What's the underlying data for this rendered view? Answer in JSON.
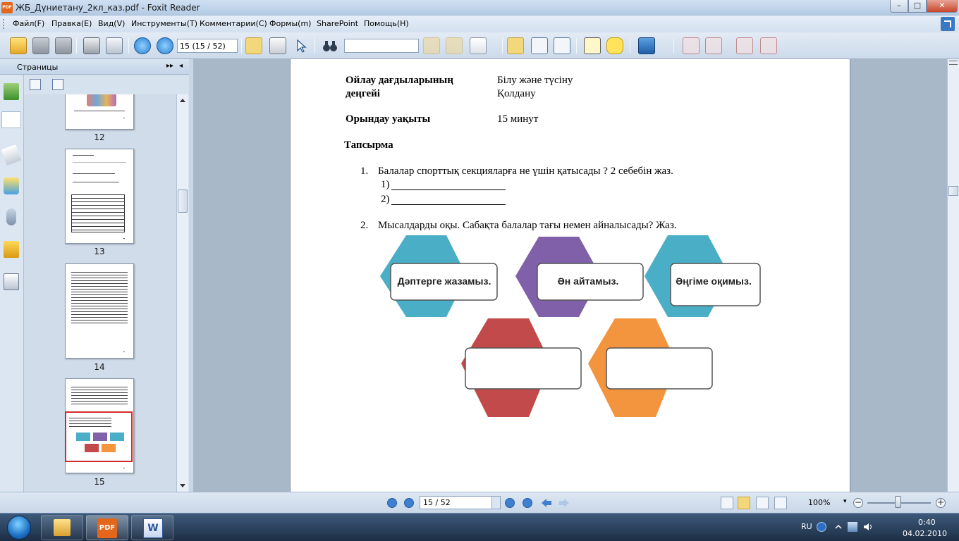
{
  "window": {
    "title": "ЖБ_Дүниетану_2кл_каз.pdf - Foxit Reader",
    "app_icon_label": "PDF",
    "minimize": "–",
    "maximize": "□",
    "close": "✕"
  },
  "menu": {
    "items": [
      "Файл(F)",
      "Правка(E)",
      "Вид(V)",
      "Инструменты(T)",
      "Комментарии(C)",
      "Формы(m)",
      "SharePoint",
      "Помощь(H)"
    ]
  },
  "toolbar": {
    "page_field": "15 (15 / 52)",
    "find_value": ""
  },
  "left_panel": {
    "title": "Страницы",
    "expand_btn": "▸▸",
    "collapse_btn": "◂",
    "thumbnails": [
      {
        "label": "12"
      },
      {
        "label": "13"
      },
      {
        "label": "14"
      },
      {
        "label": "15"
      }
    ]
  },
  "document": {
    "thinking_label_1": "Ойлау дағдыларының",
    "thinking_label_2": "деңгейі",
    "thinking_value_1": "Білу және түсіну",
    "thinking_value_2": "Қолдану",
    "time_label": "Орындау уақыты",
    "time_value": "15 минут",
    "task_heading": "Тапсырма",
    "q1_num": "1.",
    "q1_text": "Балалар спорттық секцияларға не үшін қатысады ? 2 себебін жаз.",
    "q1_a1": "1)",
    "q1_a2": "2)",
    "q2_num": "2.",
    "q2_text": "Мысалдарды оқы. Сабақта балалар тағы немен айналысады? Жаз.",
    "hex_labels": [
      "Дәптерге  жазамыз.",
      "Ән айтамыз.",
      "Әңгіме оқимыз.",
      "",
      ""
    ],
    "hex_colors": [
      "#4aaec6",
      "#8060a8",
      "#4aaec6",
      "#c24a4a",
      "#f3953f"
    ]
  },
  "statusbar": {
    "page_value": "15 / 52",
    "zoom": "100%",
    "zoom_minus": "−",
    "zoom_plus": "+"
  },
  "taskbar": {
    "language": "RU",
    "time": "0:40",
    "date": "04.02.2010",
    "pdf_label": "PDF",
    "word_label": "W"
  }
}
